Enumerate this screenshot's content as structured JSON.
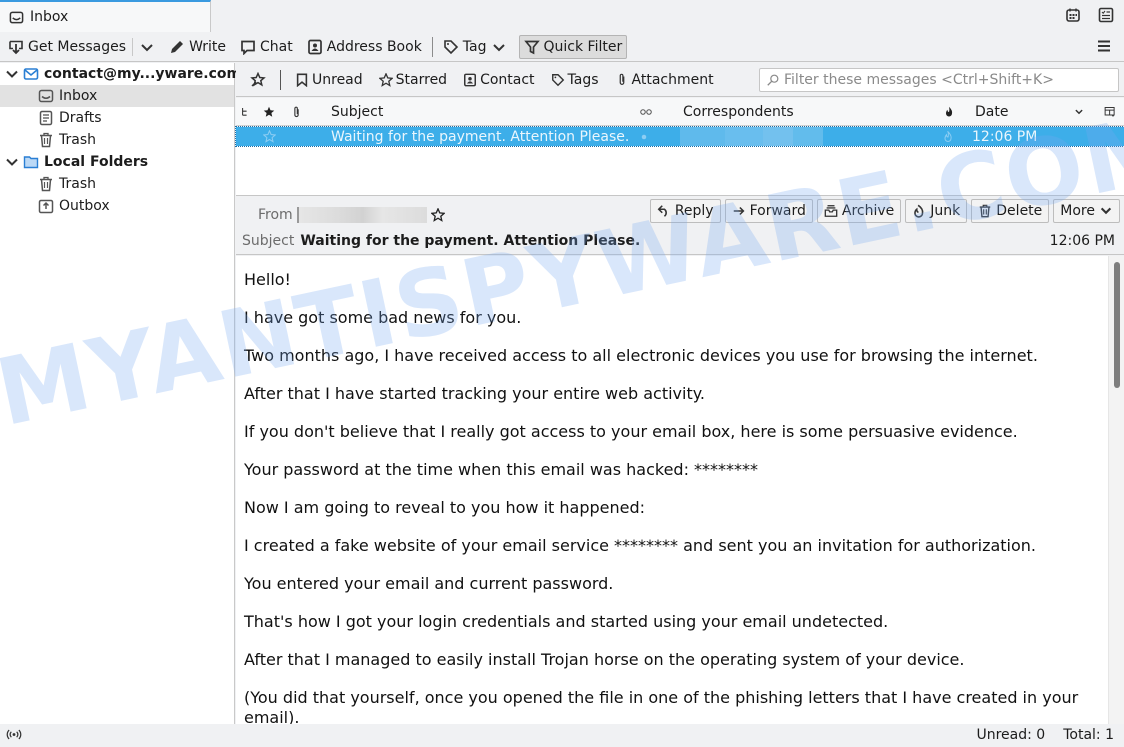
{
  "tabs": [
    {
      "label": "Inbox",
      "icon": "inbox-icon"
    }
  ],
  "top_icons": [
    "calendar-icon",
    "tasks-icon"
  ],
  "toolbar": {
    "get_messages": "Get Messages",
    "write": "Write",
    "chat": "Chat",
    "address_book": "Address Book",
    "tag": "Tag",
    "quick_filter": "Quick Filter"
  },
  "folders": [
    {
      "label": "contact@my...yware.com",
      "type": "account",
      "icon": "mail-icon",
      "expanded": true
    },
    {
      "label": "Inbox",
      "type": "folder",
      "icon": "inbox-icon",
      "selected": true
    },
    {
      "label": "Drafts",
      "type": "folder",
      "icon": "drafts-icon"
    },
    {
      "label": "Trash",
      "type": "folder",
      "icon": "trash-icon"
    },
    {
      "label": "Local Folders",
      "type": "account",
      "icon": "folder-icon",
      "expanded": true
    },
    {
      "label": "Trash",
      "type": "folder",
      "icon": "trash-icon"
    },
    {
      "label": "Outbox",
      "type": "folder",
      "icon": "outbox-icon"
    }
  ],
  "quickfilter": {
    "unread": "Unread",
    "starred": "Starred",
    "contact": "Contact",
    "tags": "Tags",
    "attachment": "Attachment",
    "search_placeholder": "Filter these messages <Ctrl+Shift+K>",
    "search_value": ""
  },
  "thread_columns": {
    "subject": "Subject",
    "correspondents": "Correspondents",
    "date": "Date"
  },
  "messages": [
    {
      "subject": "Waiting for the payment. Attention Please.",
      "correspondent": "[redacted]",
      "date": "12:06 PM",
      "starred": false,
      "selected": true
    }
  ],
  "message": {
    "from_label": "From",
    "from": "[redacted]",
    "subject_label": "Subject",
    "subject": "Waiting for the payment. Attention Please.",
    "date": "12:06 PM",
    "actions": {
      "reply": "Reply",
      "forward": "Forward",
      "archive": "Archive",
      "junk": "Junk",
      "delete": "Delete",
      "more": "More"
    },
    "body": [
      "Hello!",
      "I have got some bad news for you.",
      "Two months ago, I have received access to all electronic devices you use for browsing the internet.",
      "After that I have started tracking your entire web activity.",
      "If you don't believe that I really got access to your email box, here is some persuasive evidence.",
      "Your password at the time when this email was hacked: ********",
      "Now I am going to reveal to you how it happened:",
      "I created a fake website of your email service ******** and sent you an invitation for authorization.",
      "You entered your email and current password.",
      "That's how I got your login credentials and started using your email undetected.",
      "After that I managed to easily install Trojan horse on the operating system of your device.",
      "(You did that yourself, once you opened the file in one of the phishing letters that I have created in your email)."
    ]
  },
  "status": {
    "unread": "Unread: 0",
    "total": "Total: 1"
  },
  "watermark": "MYANTISPYWARE.COM"
}
